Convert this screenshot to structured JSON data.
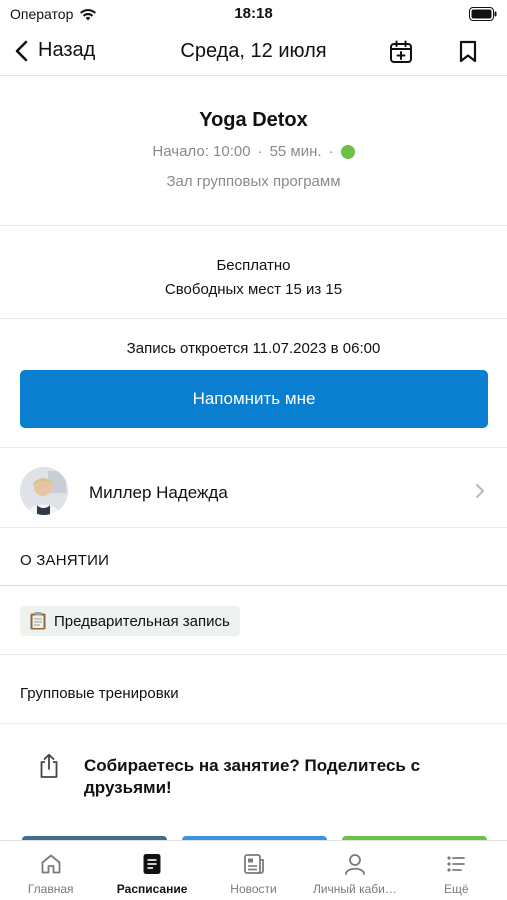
{
  "status_bar": {
    "carrier": "Оператор",
    "time": "18:18"
  },
  "nav": {
    "back_label": "Назад",
    "title": "Среда, 12 июля"
  },
  "class_info": {
    "title": "Yoga Detox",
    "start": "Начало: 10:00",
    "separator": "·",
    "duration": "55 мин.",
    "status_color": "#6cc04a",
    "hall": "Зал групповых программ"
  },
  "pricing": {
    "price": "Бесплатно",
    "spots": "Свободных мест 15 из 15"
  },
  "signup": {
    "note": "Запись откроется 11.07.2023 в 06:00",
    "remind_button": "Напомнить мне",
    "button_color": "#0a7fd0"
  },
  "trainer": {
    "name": "Миллер Надежда"
  },
  "about": {
    "title": "О ЗАНЯТИИ",
    "tag": "Предварительная запись",
    "category": "Групповые тренировки"
  },
  "share": {
    "text": "Собираетесь на занятие? Поделитесь с друзьями!"
  },
  "tabbar": {
    "items": [
      {
        "label": "Главная",
        "icon": "home-icon"
      },
      {
        "label": "Расписание",
        "icon": "schedule-icon",
        "active": true
      },
      {
        "label": "Новости",
        "icon": "news-icon"
      },
      {
        "label": "Личный каби…",
        "icon": "profile-icon"
      },
      {
        "label": "Ещё",
        "icon": "more-icon"
      }
    ]
  }
}
